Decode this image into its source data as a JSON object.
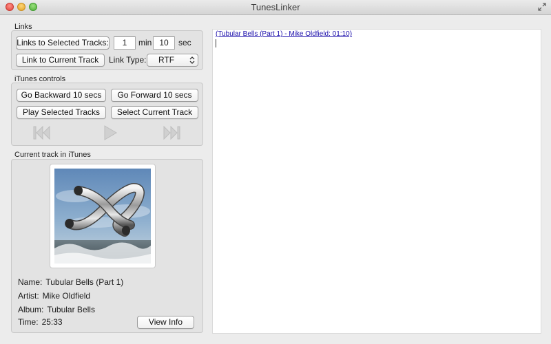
{
  "window": {
    "title": "TunesLinker"
  },
  "links": {
    "section_label": "Links",
    "selected_tracks_button": "Links to Selected Tracks:",
    "minutes_value": "1",
    "min_label": "min",
    "seconds_value": "10",
    "sec_label": "sec",
    "current_track_button": "Link to Current Track",
    "link_type_label": "Link Type:",
    "link_type_value": "RTF"
  },
  "itunes": {
    "section_label": "iTunes controls",
    "back_button": "Go Backward 10 secs",
    "forward_button": "Go Forward 10 secs",
    "play_selected_button": "Play Selected Tracks",
    "select_current_button": "Select Current Track"
  },
  "current": {
    "section_label": "Current track in iTunes",
    "name_key": "Name:",
    "name_value": "Tubular Bells (Part 1)",
    "artist_key": "Artist:",
    "artist_value": "Mike Oldfield",
    "album_key": "Album:",
    "album_value": "Tubular Bells",
    "time_key": "Time:",
    "time_value": "25:33",
    "view_info_button": "View Info"
  },
  "editor": {
    "link_text": "(Tubular Bells (Part 1) - Mike Oldfield: 01:10)"
  },
  "icons": {
    "previous": "previous-track-icon",
    "play": "play-icon",
    "next": "next-track-icon",
    "fullscreen": "fullscreen-icon"
  },
  "colors": {
    "link": "#1a0dab",
    "close": "#e0443b",
    "minimize": "#e0a124",
    "maximize": "#4eae37"
  }
}
